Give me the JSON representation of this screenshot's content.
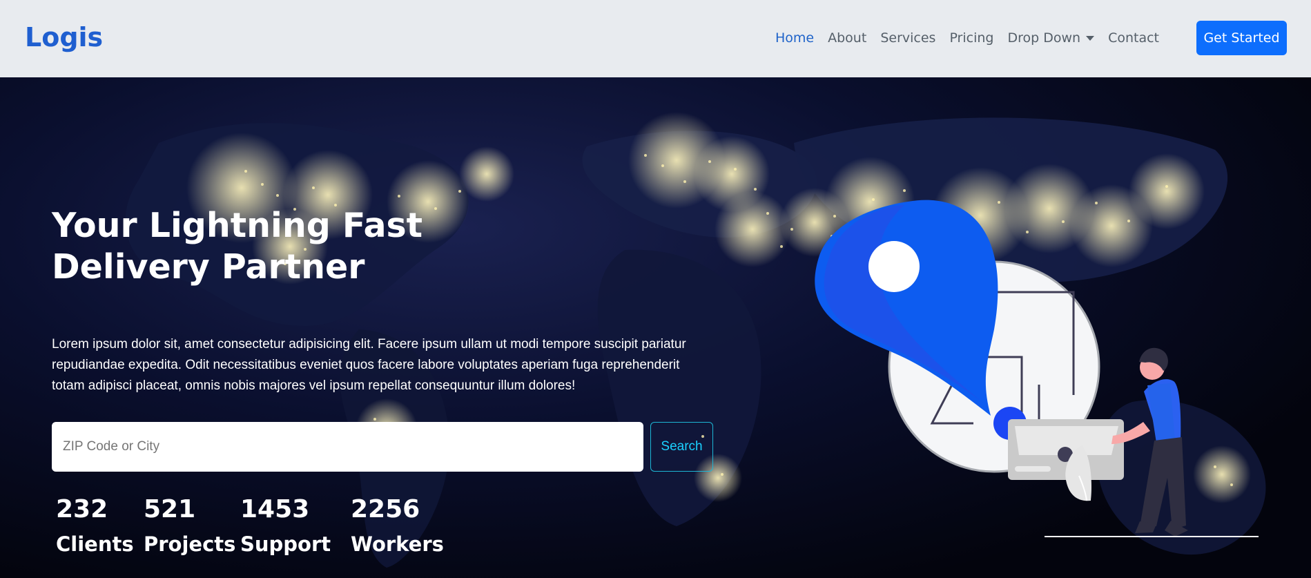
{
  "navbar": {
    "brand": "Logis",
    "items": [
      {
        "label": "Home",
        "active": true
      },
      {
        "label": "About",
        "active": false
      },
      {
        "label": "Services",
        "active": false
      },
      {
        "label": "Pricing",
        "active": false
      },
      {
        "label": "Drop Down",
        "active": false,
        "has_caret": true
      },
      {
        "label": "Contact",
        "active": false
      }
    ],
    "cta_label": "Get Started"
  },
  "hero": {
    "title_line_1": "Your Lightning Fast",
    "title_line_2": "Delivery Partner",
    "description": "Lorem ipsum dolor sit, amet consectetur adipisicing elit. Facere ipsum ullam ut modi tempore suscipit pariatur repudiandae expedita. Odit necessitatibus eveniet quos facere labore voluptates aperiam fuga reprehenderit totam adipisci placeat, omnis nobis majores vel ipsum repellat consequuntur illum dolores!",
    "search": {
      "placeholder": "ZIP Code or City",
      "button_label": "Search"
    },
    "stats": [
      {
        "value": "232",
        "label": "Clients"
      },
      {
        "value": "521",
        "label": "Projects"
      },
      {
        "value": "1453",
        "label": "Support"
      },
      {
        "value": "2256",
        "label": "Workers"
      }
    ]
  },
  "colors": {
    "brand": "#1f5fd0",
    "cta": "#0d6efd",
    "hero_background": "#05071a",
    "search_border": "#1db7d6"
  },
  "icons": [
    "dropdown-caret-icon",
    "location-pin-icon",
    "delivery-person-icon"
  ]
}
